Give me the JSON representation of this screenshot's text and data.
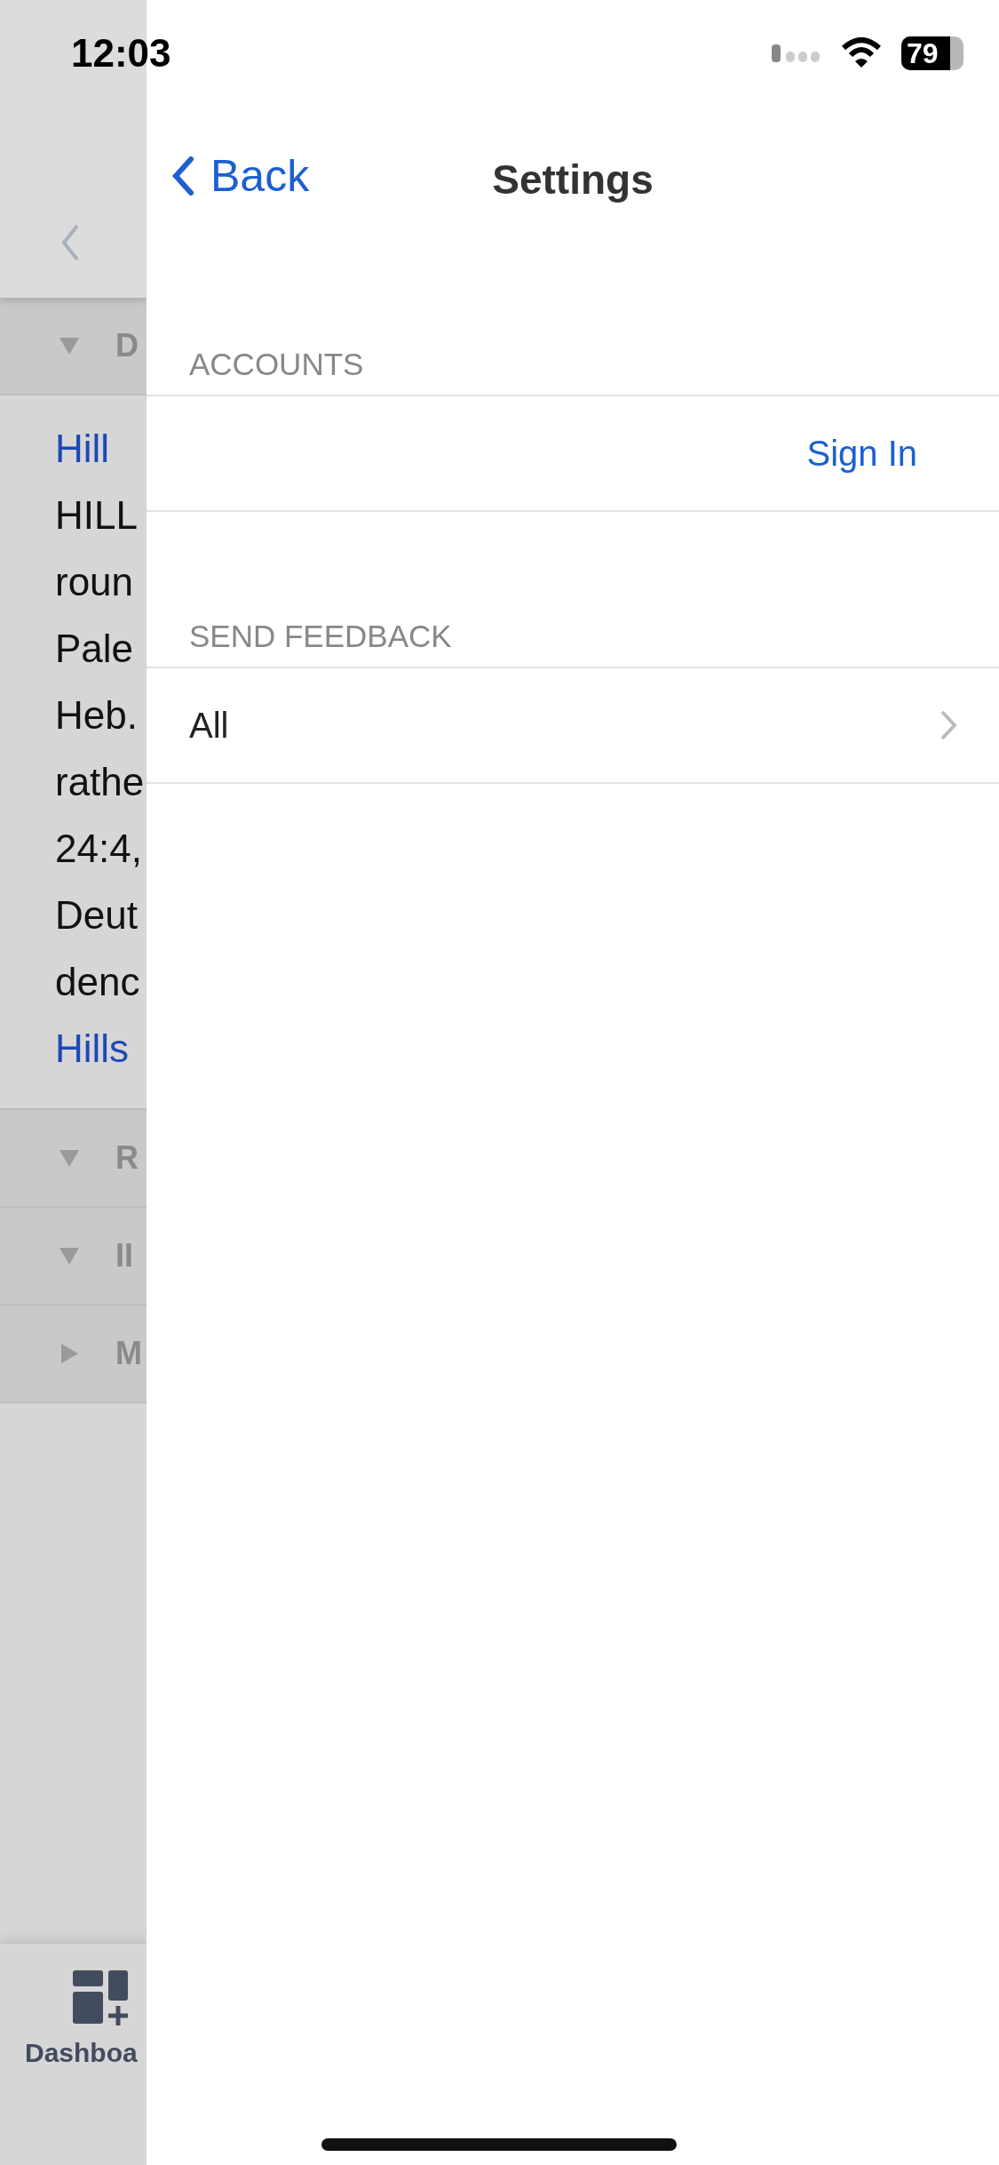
{
  "status_bar": {
    "time": "12:03",
    "battery": "79"
  },
  "background_page": {
    "sections": [
      {
        "title": "D",
        "expanded": true,
        "content": {
          "link": "Hill",
          "lines": [
            "HILL",
            "roun",
            "Pale",
            "Heb.",
            "rathe",
            "24:4,",
            "Deut",
            "denc"
          ],
          "footer_link": "Hills"
        }
      },
      {
        "title": "R",
        "expanded": true
      },
      {
        "title": "II",
        "expanded": true
      },
      {
        "title": "M",
        "expanded": false
      }
    ],
    "tab_bar": {
      "tabs": [
        {
          "label": "Dashboa"
        }
      ]
    }
  },
  "settings": {
    "back": "Back",
    "title": "Settings",
    "groups": [
      {
        "header": "ACCOUNTS",
        "rows": [
          {
            "kind": "action",
            "label": "Sign In"
          }
        ]
      },
      {
        "header": "SEND FEEDBACK",
        "rows": [
          {
            "kind": "disclosure",
            "label": "All"
          }
        ]
      }
    ]
  }
}
